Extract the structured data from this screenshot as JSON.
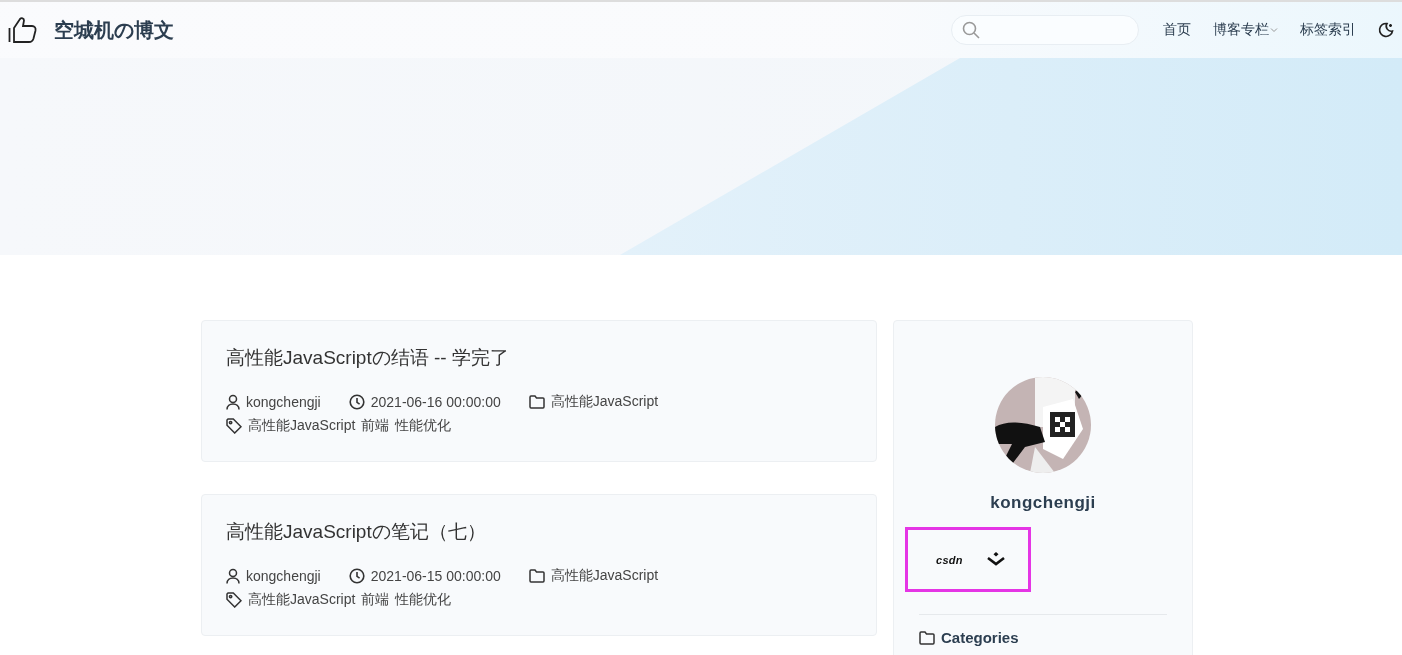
{
  "header": {
    "title": "空城机の博文",
    "nav": [
      {
        "label": "首页",
        "dropdown": false
      },
      {
        "label": "博客专栏",
        "dropdown": true
      },
      {
        "label": "标签索引",
        "dropdown": false
      }
    ]
  },
  "posts": [
    {
      "title": "高性能JavaScriptの结语 -- 学完了",
      "author": "kongchengji",
      "date": "2021-06-16 00:00:00",
      "category": "高性能JavaScript",
      "tags": [
        "高性能JavaScript",
        "前端",
        "性能优化"
      ]
    },
    {
      "title": "高性能JavaScriptの笔记（七）",
      "author": "kongchengji",
      "date": "2021-06-15 00:00:00",
      "category": "高性能JavaScript",
      "tags": [
        "高性能JavaScript",
        "前端",
        "性能优化"
      ]
    }
  ],
  "profile": {
    "name": "kongchengji",
    "links_highlighted": true,
    "links": [
      {
        "kind": "csdn",
        "label": "csdn"
      },
      {
        "kind": "juejin"
      }
    ]
  },
  "sidebar_section": {
    "title": "Categories"
  }
}
